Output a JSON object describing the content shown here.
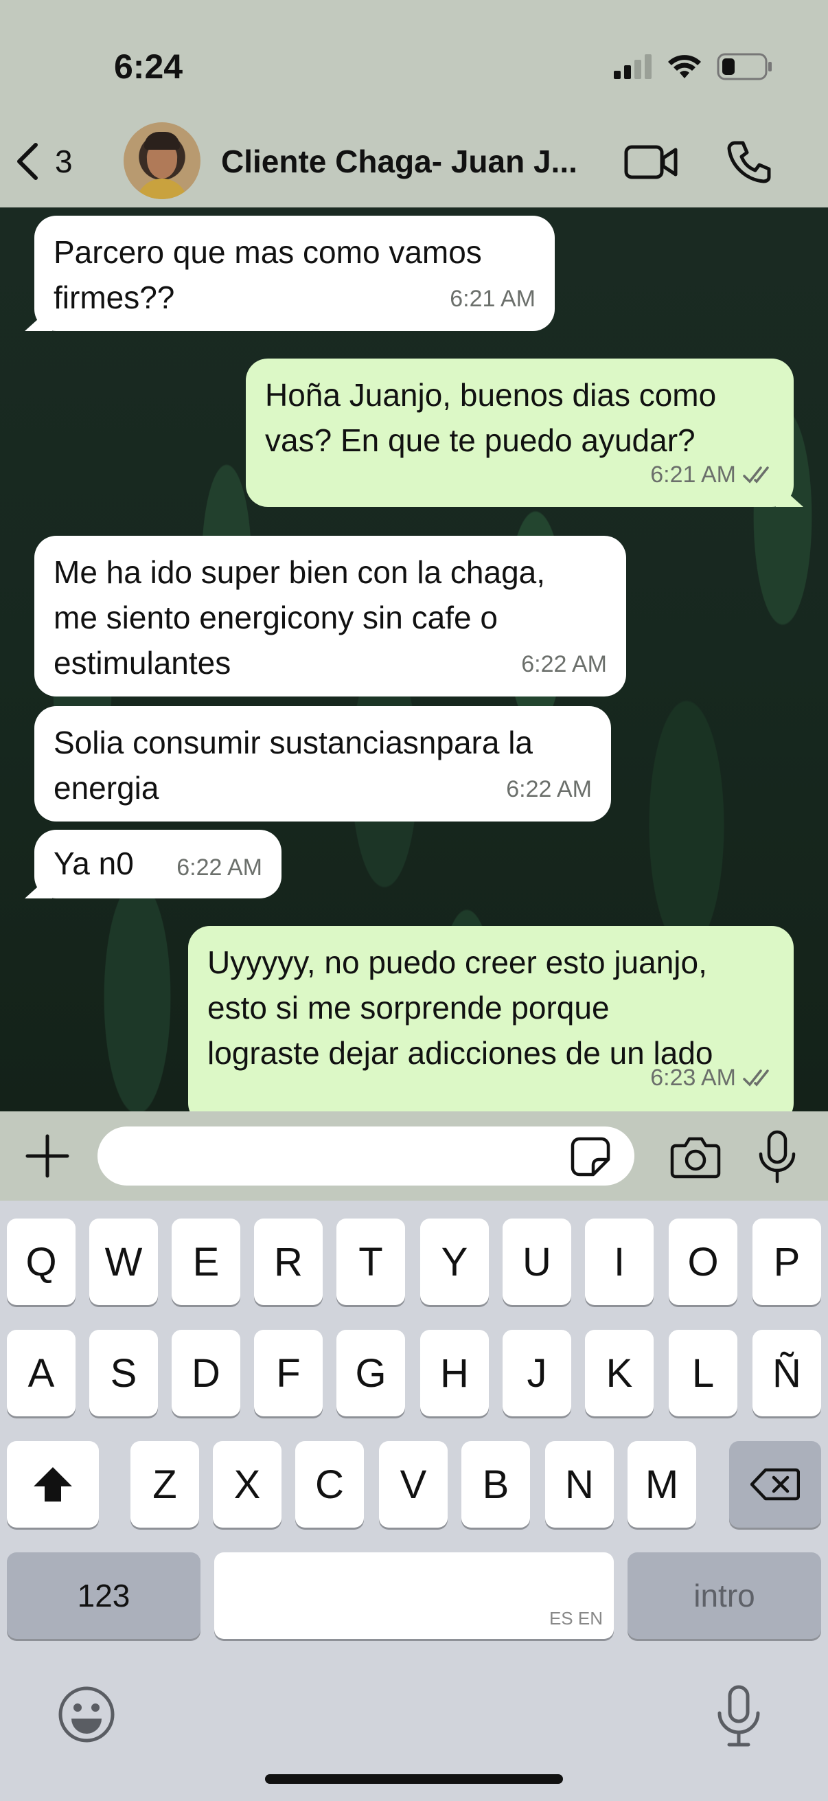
{
  "status_bar": {
    "time": "6:24"
  },
  "header": {
    "back_count": "3",
    "contact_name": "Cliente Chaga- Juan J..."
  },
  "messages": [
    {
      "direction": "in",
      "text_lines": [
        "Parcero que mas como vamos",
        "firmes??"
      ],
      "time": "6:21 AM"
    },
    {
      "direction": "out",
      "text_lines": [
        "Hoña Juanjo, buenos dias como",
        "vas? En que te puedo ayudar?"
      ],
      "time": "6:21 AM",
      "read": true
    },
    {
      "direction": "in",
      "text_lines": [
        "Me ha ido super bien con la chaga,",
        "me siento energicony sin cafe o",
        "estimulantes"
      ],
      "time": "6:22 AM"
    },
    {
      "direction": "in",
      "text_lines": [
        "Solia consumir sustanciasnpara la",
        "energia"
      ],
      "time": "6:22 AM"
    },
    {
      "direction": "in",
      "text_lines": [
        "Ya n0"
      ],
      "time": "6:22 AM"
    },
    {
      "direction": "out",
      "text_lines": [
        "Uyyyyy, no puedo creer esto juanjo,",
        "esto si me sorprende porque",
        "lograste dejar adicciones de un lado"
      ],
      "time": "6:23 AM",
      "read": true
    }
  ],
  "input": {
    "value": "",
    "placeholder": ""
  },
  "keyboard": {
    "row1": [
      "Q",
      "W",
      "E",
      "R",
      "T",
      "Y",
      "U",
      "I",
      "O",
      "P"
    ],
    "row2": [
      "A",
      "S",
      "D",
      "F",
      "G",
      "H",
      "J",
      "K",
      "L",
      "Ñ"
    ],
    "row3": [
      "Z",
      "X",
      "C",
      "V",
      "B",
      "N",
      "M"
    ],
    "numbers_key": "123",
    "space_hint": "ES EN",
    "return_key": "intro"
  },
  "icons": {
    "back": "chevron-left-icon",
    "video": "video-camera-icon",
    "call": "phone-icon",
    "plus": "plus-icon",
    "sticker": "sticker-icon",
    "camera": "camera-icon",
    "mic": "microphone-icon",
    "shift": "shift-icon",
    "delete": "delete-icon",
    "emoji": "emoji-icon",
    "dictation": "dictation-mic-icon"
  },
  "colors": {
    "header_bg": "#c2c9be",
    "incoming_bubble": "#ffffff",
    "outgoing_bubble": "#dcf8c6",
    "read_ticks": "#6b6f6b"
  }
}
